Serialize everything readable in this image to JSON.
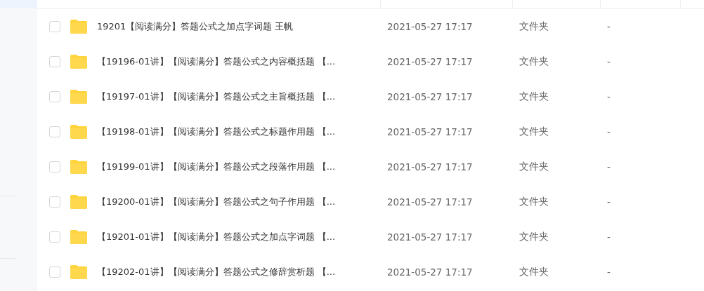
{
  "files": [
    {
      "name": "19201【阅读满分】答题公式之加点字词题 王帆",
      "modified": "2021-05-27 17:17",
      "type": "文件夹",
      "size": "-",
      "checked": false
    },
    {
      "name": "【19196-01讲】【阅读满分】答题公式之内容概括题 【...",
      "modified": "2021-05-27 17:17",
      "type": "文件夹",
      "size": "-",
      "checked": false
    },
    {
      "name": "【19197-01讲】【阅读满分】答题公式之主旨概括题 【...",
      "modified": "2021-05-27 17:17",
      "type": "文件夹",
      "size": "-",
      "checked": false
    },
    {
      "name": "【19198-01讲】【阅读满分】答题公式之标题作用题 【...",
      "modified": "2021-05-27 17:17",
      "type": "文件夹",
      "size": "-",
      "checked": false
    },
    {
      "name": "【19199-01讲】【阅读满分】答题公式之段落作用题 【...",
      "modified": "2021-05-27 17:17",
      "type": "文件夹",
      "size": "-",
      "checked": false
    },
    {
      "name": "【19200-01讲】【阅读满分】答题公式之句子作用题 【...",
      "modified": "2021-05-27 17:17",
      "type": "文件夹",
      "size": "-",
      "checked": false
    },
    {
      "name": "【19201-01讲】【阅读满分】答题公式之加点字词题 【...",
      "modified": "2021-05-27 17:17",
      "type": "文件夹",
      "size": "-",
      "checked": false
    },
    {
      "name": "【19202-01讲】【阅读满分】答题公式之修辞赏析题 【...",
      "modified": "2021-05-27 17:17",
      "type": "文件夹",
      "size": "-",
      "checked": false
    }
  ]
}
